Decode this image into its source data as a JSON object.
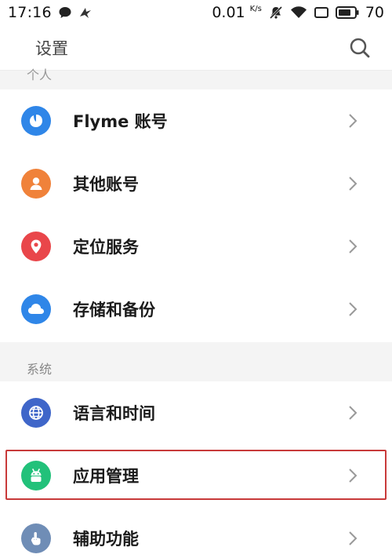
{
  "status_bar": {
    "time": "17:16",
    "speed_value": "0.01",
    "speed_unit": "K/s",
    "battery_level": "70"
  },
  "header": {
    "title": "设置"
  },
  "sections": {
    "personal_peek_label": "个人",
    "system_label": "系统"
  },
  "personal_items": [
    {
      "label": "Flyme 账号",
      "icon": "flyme-account-icon",
      "color": "#2f86e8"
    },
    {
      "label": "其他账号",
      "icon": "user-icon",
      "color": "#f0823a"
    },
    {
      "label": "定位服务",
      "icon": "location-pin-icon",
      "color": "#e9464a"
    },
    {
      "label": "存储和备份",
      "icon": "cloud-icon",
      "color": "#2f86e8"
    }
  ],
  "system_items": [
    {
      "label": "语言和时间",
      "icon": "globe-icon",
      "color": "#3f66c9"
    },
    {
      "label": "应用管理",
      "icon": "android-icon",
      "color": "#22c17a"
    },
    {
      "label": "辅助功能",
      "icon": "hand-pointer-icon",
      "color": "#6f8db6"
    }
  ],
  "colors": {
    "highlight": "#c83a3a",
    "background": "#f4f4f4"
  }
}
